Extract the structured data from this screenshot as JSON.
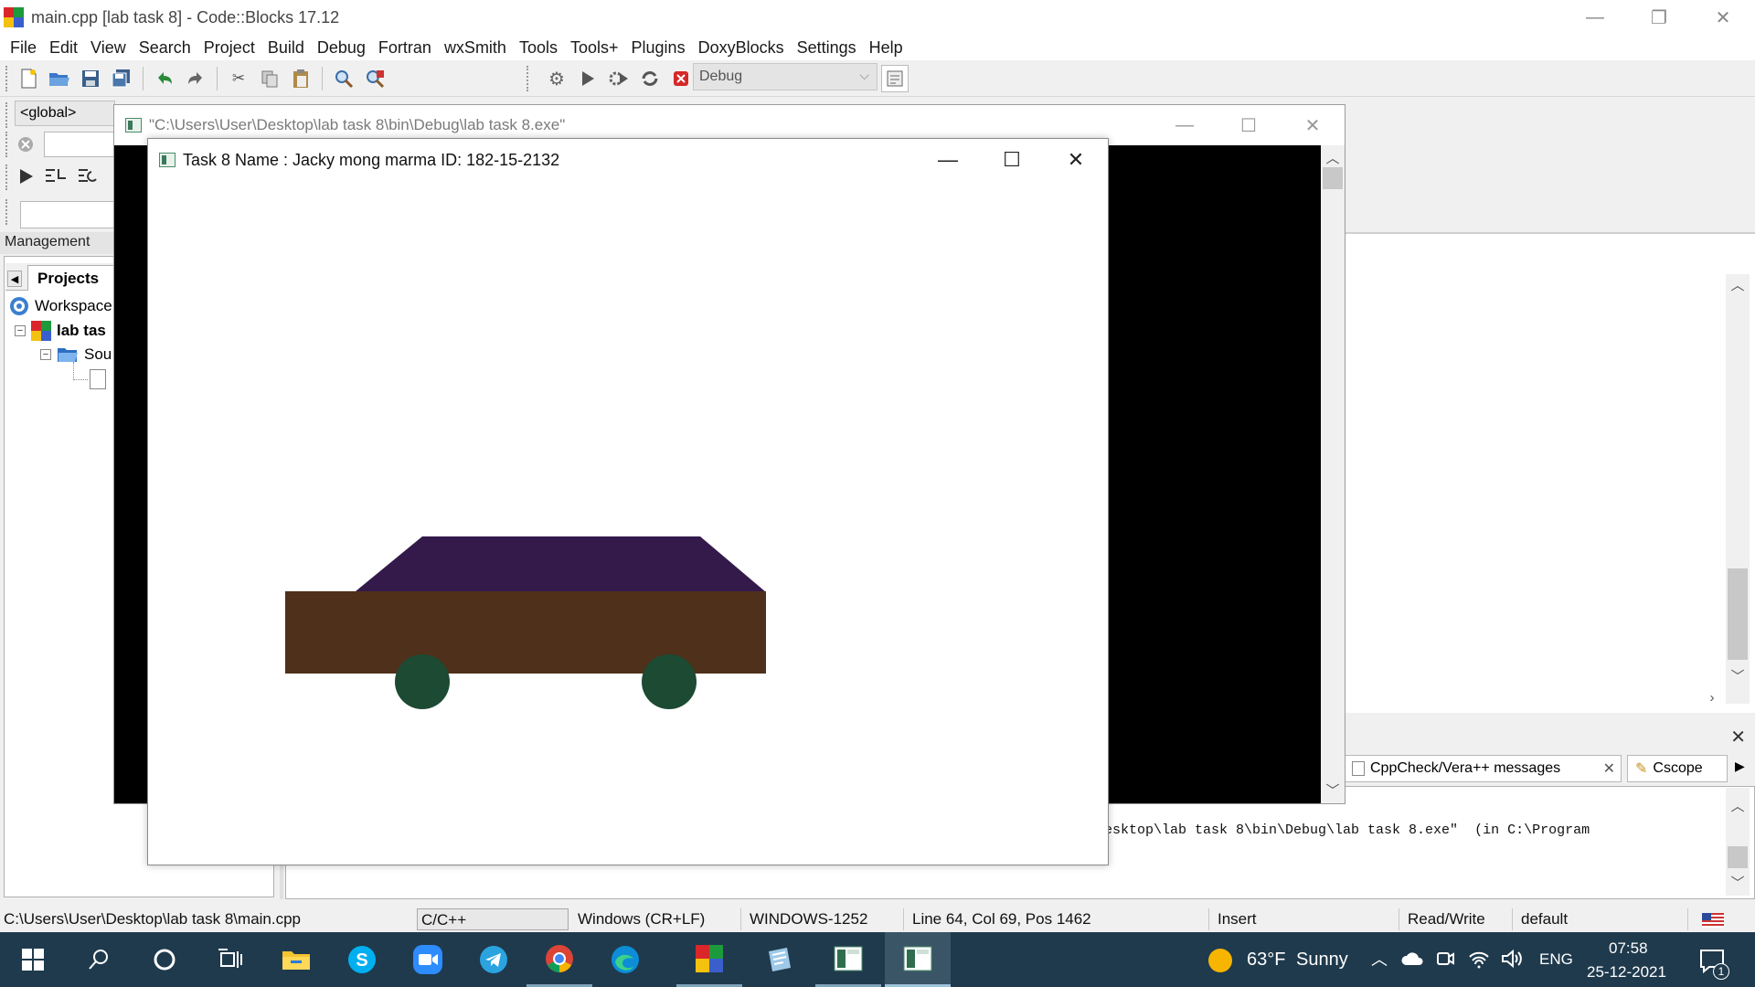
{
  "app": {
    "title": "main.cpp [lab task 8] - Code::Blocks 17.12",
    "window_controls": {
      "minimize": "—",
      "restore": "❐",
      "close": "✕"
    }
  },
  "menu": [
    "File",
    "Edit",
    "View",
    "Search",
    "Project",
    "Build",
    "Debug",
    "Fortran",
    "wxSmith",
    "Tools",
    "Tools+",
    "Plugins",
    "DoxyBlocks",
    "Settings",
    "Help"
  ],
  "toolbar": {
    "build_target": "Debug",
    "scope": "<global>"
  },
  "management": {
    "header": "Management",
    "tab": "Projects",
    "tree": {
      "workspace": "Workspace",
      "project": "lab tas",
      "sources": "Sou"
    }
  },
  "console_window": {
    "title": "\"C:\\Users\\User\\Desktop\\lab task 8\\bin\\Debug\\lab task 8.exe\""
  },
  "gl_window": {
    "title": "Task 8 Name : Jacky mong marma ID: 182-15-2132",
    "scene": {
      "roof_color": "#341a4a",
      "body_color": "#4f301a",
      "wheel_color": "#1c4a33",
      "background": "#ffffff"
    }
  },
  "messages": {
    "tabs": [
      "CppCheck/Vera++ messages",
      "Cscope"
    ],
    "log_line": "esktop\\lab task 8\\bin\\Debug\\lab task 8.exe\"  (in C:\\Program"
  },
  "status": {
    "file_path": "C:\\Users\\User\\Desktop\\lab task 8\\main.cpp",
    "language": "C/C++",
    "line_endings": "Windows (CR+LF)",
    "encoding": "WINDOWS-1252",
    "position": "Line 64, Col 69, Pos 1462",
    "mode": "Insert",
    "access": "Read/Write",
    "profile": "default"
  },
  "taskbar": {
    "weather_temp": "63°F",
    "weather_text": "Sunny",
    "language": "ENG",
    "time": "07:58",
    "date": "25-12-2021",
    "notification_count": "1"
  }
}
